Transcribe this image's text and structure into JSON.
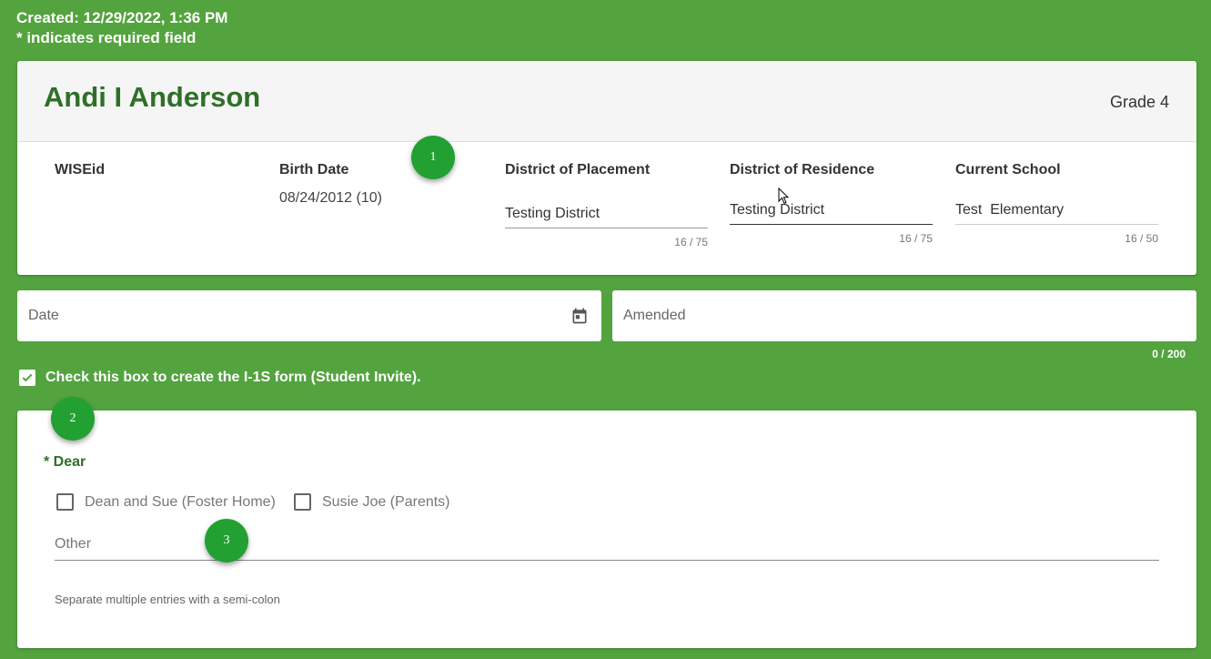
{
  "meta": {
    "created": "Created: 12/29/2022, 1:36 PM",
    "required_note": "* indicates required field"
  },
  "student": {
    "name": "Andi I Anderson",
    "grade": "Grade 4",
    "wiseid_label": "WISEid",
    "birth_date_label": "Birth Date",
    "birth_date": "08/24/2012 (10)",
    "placement_label": "District of Placement",
    "placement": "Testing District",
    "placement_count": "16 / 75",
    "residence_label": "District of Residence",
    "residence": "Testing District",
    "residence_count": "16 / 75",
    "school_label": "Current School",
    "school": "Test  Elementary",
    "school_count": "16 / 50"
  },
  "form": {
    "date_placeholder": "Date",
    "amended_placeholder": "Amended",
    "amended_count": "0 / 200",
    "invite_checkbox_label": "Check this box to create the I-1S form (Student Invite).",
    "invite_checked": true
  },
  "dear": {
    "label": "* Dear",
    "options": [
      {
        "label": "Dean and Sue (Foster Home)",
        "checked": false
      },
      {
        "label": "Susie Joe (Parents)",
        "checked": false
      }
    ],
    "other_placeholder": "Other",
    "hint": "Separate multiple entries with a semi-colon"
  },
  "markers": [
    "1",
    "2",
    "3"
  ],
  "colors": {
    "background": "#53a33f",
    "accent": "#2f6f28",
    "marker": "#22a032"
  },
  "icons": {
    "calendar": "calendar-icon",
    "check": "check-icon",
    "cursor": "mouse-cursor-icon"
  }
}
